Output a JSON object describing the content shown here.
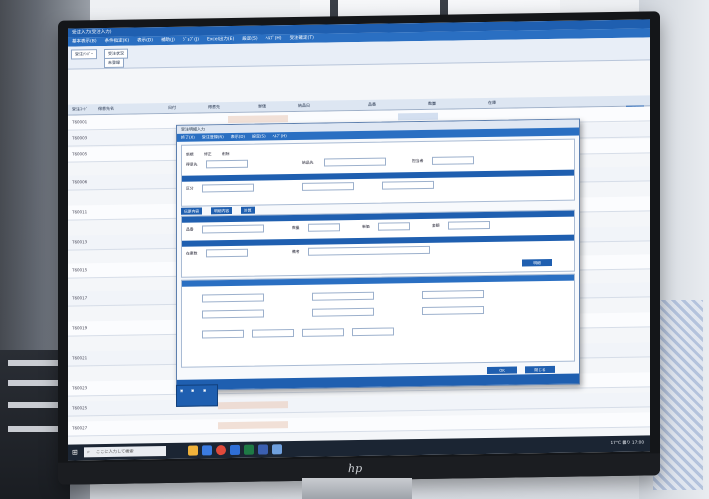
{
  "app": {
    "title": "受注入力(受注入力)",
    "menu": [
      "基本表示(B)",
      "条件指定(K)",
      "表示(D)",
      "補助(J)",
      "ｼﾞｮﾌﾞ(J)",
      "Excel出力(E)",
      "設定(S)",
      "ﾍﾙﾌﾟ(H)",
      "受注確定(T)"
    ],
    "subbar_labels": [
      "受注ﾅﾝﾊﾞｰ",
      "受注状況",
      "未登録"
    ],
    "grid_headers": [
      "受注ｺｰﾄﾞ",
      "得意先名",
      "日付",
      "得意先",
      "単価",
      "納品日",
      "品番",
      "数量",
      "在庫"
    ],
    "row_ids": [
      "T60001",
      "T60003",
      "T60005",
      "T60006",
      "T60011",
      "T60013",
      "T60015",
      "T60017",
      "T60019",
      "T60021",
      "T60023",
      "T60025",
      "T60027"
    ],
    "side_button": "検索"
  },
  "dialog": {
    "title": "受注明細入力",
    "menu": [
      "終了(X)",
      "受注登録(R)",
      "表示(D)",
      "設定(S)",
      "ﾍﾙﾌﾟ(H)"
    ],
    "radios": [
      "新規",
      "修正",
      "削除"
    ],
    "tabs": [
      "伝票内容",
      "明細内容",
      "計算"
    ],
    "labels": [
      "得意先",
      "納品先",
      "担当者",
      "区分",
      "品番",
      "数量",
      "単価",
      "金額",
      "在庫数",
      "備考"
    ],
    "ok_button": "OK",
    "cancel_button": "閉じる",
    "line_button": "明細"
  },
  "taskbar": {
    "search_placeholder": "ここに入力して検索",
    "time": "17:00",
    "tray": "17°C 曇り"
  },
  "monitor": {
    "logo": "hp"
  }
}
